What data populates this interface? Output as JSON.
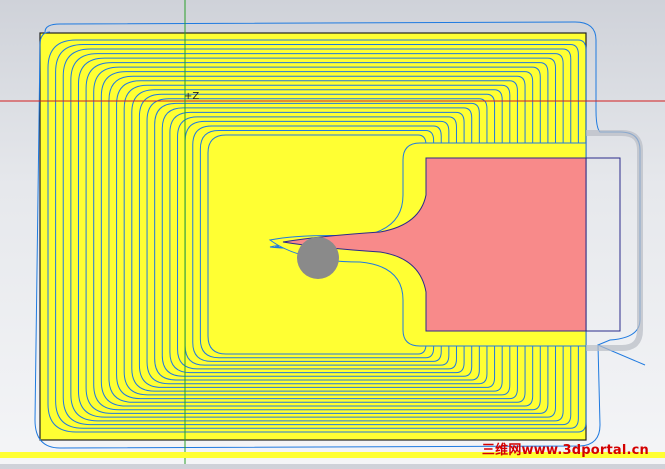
{
  "viewport": {
    "coordinate_label": "+Z",
    "watermark": "三维网www.3dportal.cn"
  },
  "colors": {
    "background_top": "#cfd2d9",
    "background_bottom": "#f4f5f7",
    "stock_fill": "#ffff33",
    "part_outline": "#222222",
    "toolpath": "#1f7ae0",
    "pocket_fill": "#f88a8a",
    "pocket_outline": "#2b2b8c",
    "tool": "#8a8a8a",
    "axis_x": "#d21f1f",
    "axis_y": "#2aa02a"
  },
  "icons": [
    "tool-cutter-icon",
    "origin-crosshair-icon"
  ]
}
